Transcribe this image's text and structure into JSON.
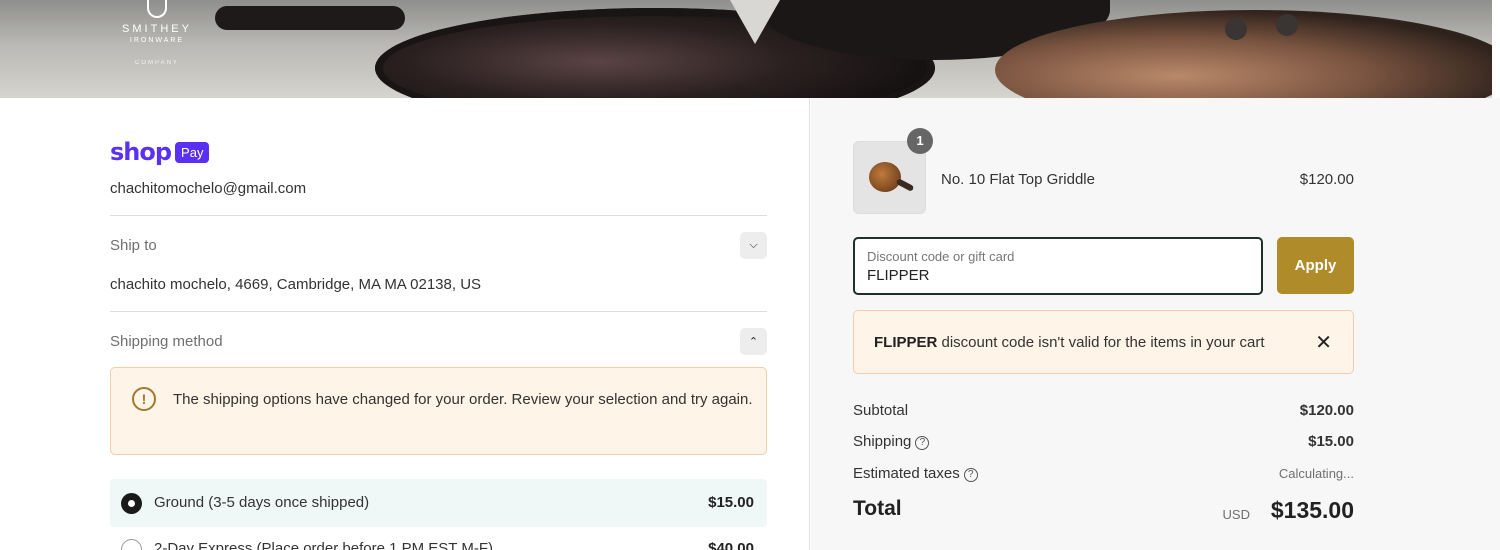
{
  "brand": {
    "logo_name": "SMITHEY",
    "logo_sub": "IRONWARE",
    "logo_co": "COMPANY"
  },
  "contact": {
    "shoppay_word": "shop",
    "shoppay_badge": "Pay",
    "email": "chachitomochelo@gmail.com"
  },
  "ship_to": {
    "label": "Ship to",
    "address": "chachito mochelo, 4669, Cambridge, MA MA 02138, US"
  },
  "shipping_method": {
    "label": "Shipping method",
    "notice": "The shipping options have changed for your order. Review your selection and try again.",
    "options": [
      {
        "label": "Ground (3-5 days once shipped)",
        "price": "$15.00",
        "selected": true
      },
      {
        "label": "2-Day Express (Place order before 1 PM EST M-F)",
        "price": "$40.00",
        "selected": false
      }
    ]
  },
  "cart": {
    "quantity": "1",
    "product_name": "No. 10 Flat Top Griddle",
    "product_price": "$120.00"
  },
  "discount": {
    "placeholder": "Discount code or gift card",
    "value": "FLIPPER",
    "apply_label": "Apply",
    "error_code": "FLIPPER",
    "error_msg": " discount code isn't valid for the items in your cart"
  },
  "summary": {
    "subtotal_label": "Subtotal",
    "subtotal_value": "$120.00",
    "shipping_label": "Shipping",
    "shipping_value": "$15.00",
    "taxes_label": "Estimated taxes",
    "taxes_value": "Calculating...",
    "total_label": "Total",
    "currency": "USD",
    "total_value": "$135.00"
  },
  "colors": {
    "shoppay": "#5a31f4",
    "apply_button": "#b08b2a",
    "notice_bg": "#fff4e8"
  }
}
